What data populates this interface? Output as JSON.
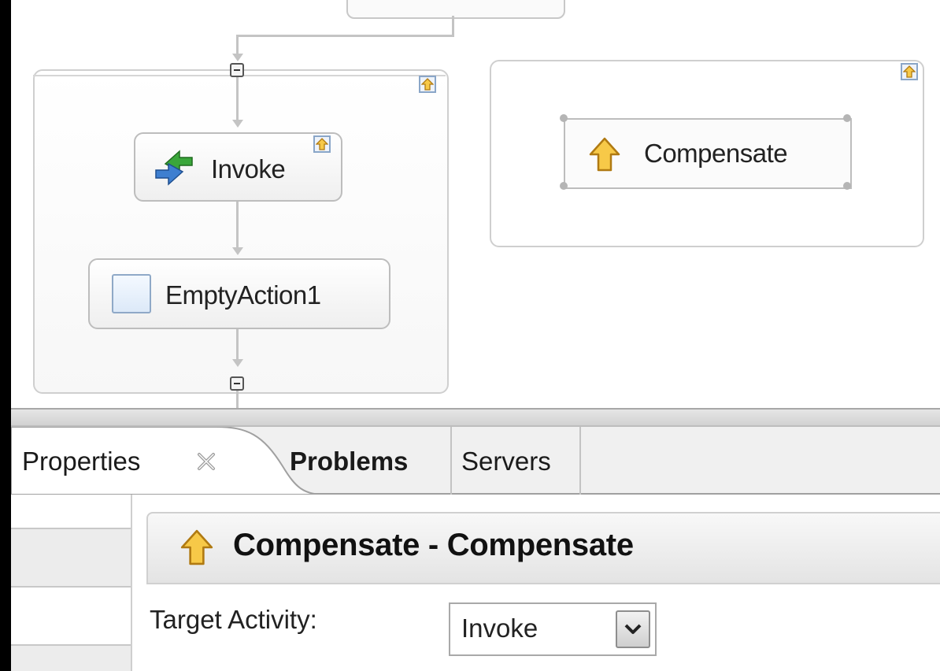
{
  "canvas": {
    "invoke_label": "Invoke",
    "empty_action_label": "EmptyAction1",
    "compensate_label": "Compensate"
  },
  "tabs": [
    {
      "label": "Properties",
      "active": true
    },
    {
      "label": "Problems",
      "active": false
    },
    {
      "label": "Servers",
      "active": false
    }
  ],
  "properties": {
    "header_title": "Compensate - Compensate",
    "target_activity_label": "Target Activity:",
    "target_activity_value": "Invoke"
  },
  "colors": {
    "arrow_up_fill": "#f7c948",
    "arrow_up_stroke": "#b07a12",
    "invoke_green": "#3aa63a",
    "invoke_blue": "#3e7fd0",
    "connector": "#c4c4c4"
  },
  "icons": [
    "compensate-up-arrow-icon",
    "invoke-arrows-icon",
    "empty-action-icon",
    "collapse-icon",
    "close-icon",
    "dropdown-chevron-icon"
  ]
}
